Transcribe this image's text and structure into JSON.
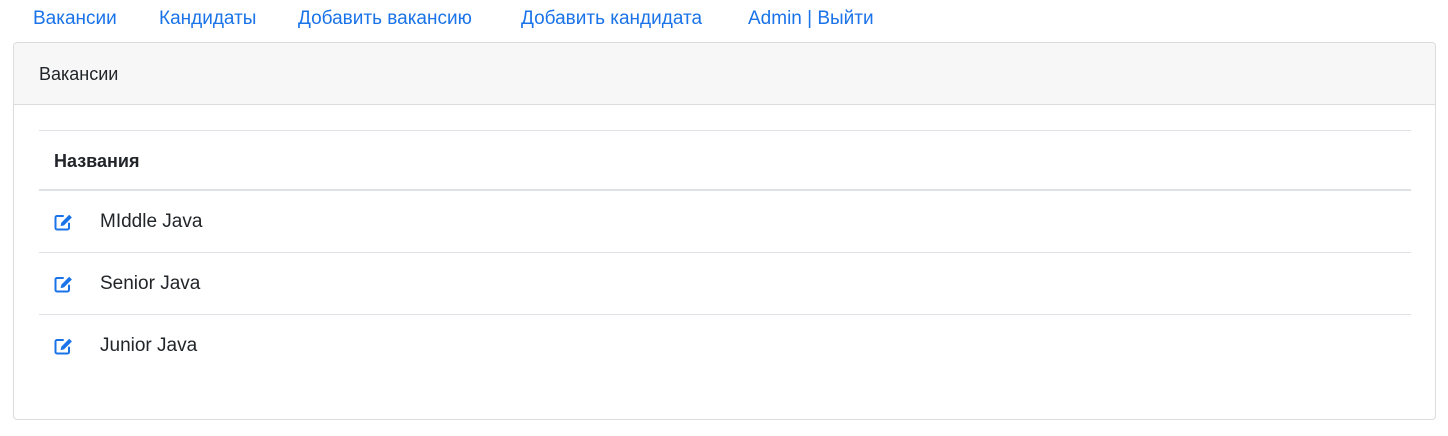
{
  "nav": {
    "items": [
      {
        "label": "Вакансии"
      },
      {
        "label": "Кандидаты"
      },
      {
        "label": "Добавить вакансию"
      },
      {
        "label": "Добавить кандидата"
      },
      {
        "label": "Admin | Выйти"
      }
    ]
  },
  "card": {
    "title": "Вакансии",
    "table": {
      "header": "Названия",
      "rows": [
        {
          "name": "MIddle Java"
        },
        {
          "name": "Senior Java"
        },
        {
          "name": "Junior Java"
        }
      ]
    }
  },
  "colors": {
    "link": "#1a73e8",
    "text": "#212529",
    "header_bg": "#f7f7f7",
    "border": "#dee2e6"
  },
  "icons": {
    "edit": "edit-icon"
  }
}
